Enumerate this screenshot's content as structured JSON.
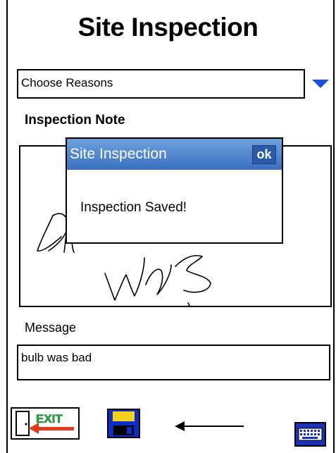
{
  "app": {
    "title": "Site Inspection"
  },
  "reasons": {
    "value": "Choose Reasons"
  },
  "note": {
    "label": "Inspection Note"
  },
  "message": {
    "label": "Message",
    "value": "bulb was bad"
  },
  "dialog": {
    "title": "Site Inspection",
    "ok_label": "ok",
    "message": "Inspection Saved!"
  },
  "toolbar": {
    "exit_label": "EXIT"
  },
  "icons": {
    "dropdown": "chevron-down-icon",
    "exit": "exit-door-icon",
    "save": "floppy-disk-icon",
    "keyboard": "keyboard-icon",
    "pointer": "left-arrow-icon"
  },
  "colors": {
    "accent": "#1c4fe0",
    "dialog_header": "#3a6fc2",
    "save_icon": "#0a2fc8",
    "exit_icon": "#2ea84a"
  }
}
